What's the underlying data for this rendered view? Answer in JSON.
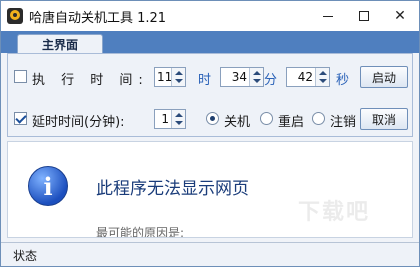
{
  "window": {
    "title": "哈唐自动关机工具 1.21"
  },
  "tabs": [
    {
      "label": "主界面"
    }
  ],
  "exec_time": {
    "label": "执 行 时 间:",
    "hour": "11",
    "hour_unit": "时",
    "minute": "34",
    "minute_unit": "分",
    "second": "42",
    "second_unit": "秒",
    "start_label": "启动",
    "checked": false
  },
  "delay": {
    "label": "延时时间(分钟):",
    "minutes": "1",
    "checked": true,
    "options": [
      {
        "label": "关机",
        "selected": true
      },
      {
        "label": "重启",
        "selected": false
      },
      {
        "label": "注销",
        "selected": false
      }
    ],
    "cancel_label": "取消"
  },
  "webview": {
    "title": "此程序无法显示网页",
    "subtitle": "最可能的原因是:",
    "watermark": "下载吧"
  },
  "status": {
    "text": "状态"
  }
}
